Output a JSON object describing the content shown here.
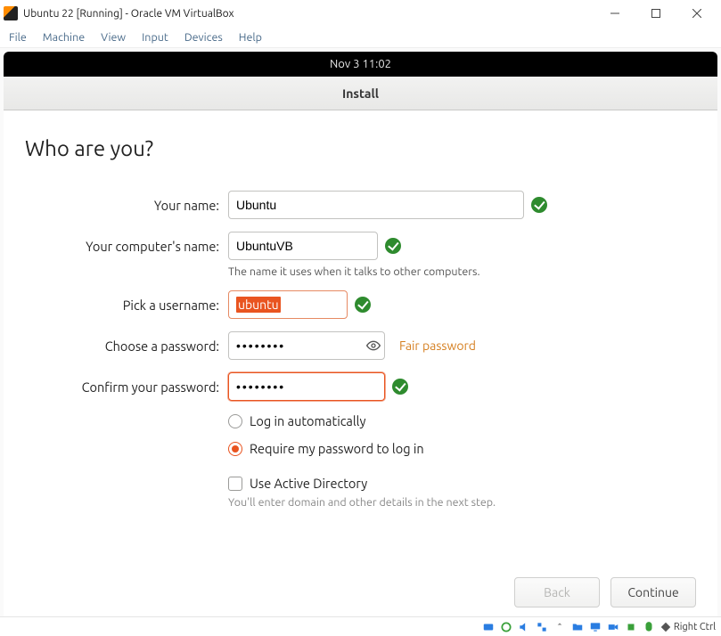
{
  "vb": {
    "title": "Ubuntu 22 [Running] - Oracle VM VirtualBox",
    "menu": {
      "file": "File",
      "machine": "Machine",
      "view": "View",
      "input": "Input",
      "devices": "Devices",
      "help": "Help"
    },
    "hostkey": "Right Ctrl"
  },
  "topbar": {
    "datetime": "Nov 3  11:02"
  },
  "installer": {
    "header_title": "Install",
    "heading": "Who are you?",
    "labels": {
      "name": "Your name:",
      "comp": "Your computer's name:",
      "user": "Pick a username:",
      "pwd": "Choose a password:",
      "confirm": "Confirm your password:"
    },
    "values": {
      "name": "Ubuntu",
      "comp": "UbuntuVB",
      "user": "ubuntu",
      "pwd": "••••••••",
      "confirm": "••••••••"
    },
    "hints": {
      "comp": "The name it uses when it talks to other computers.",
      "fair": "Fair password",
      "ad": "You'll enter domain and other details in the next step."
    },
    "options": {
      "auto_login": "Log in automatically",
      "require_pwd": "Require my password to log in",
      "use_ad": "Use Active Directory"
    },
    "nav": {
      "back": "Back",
      "continue": "Continue"
    }
  }
}
